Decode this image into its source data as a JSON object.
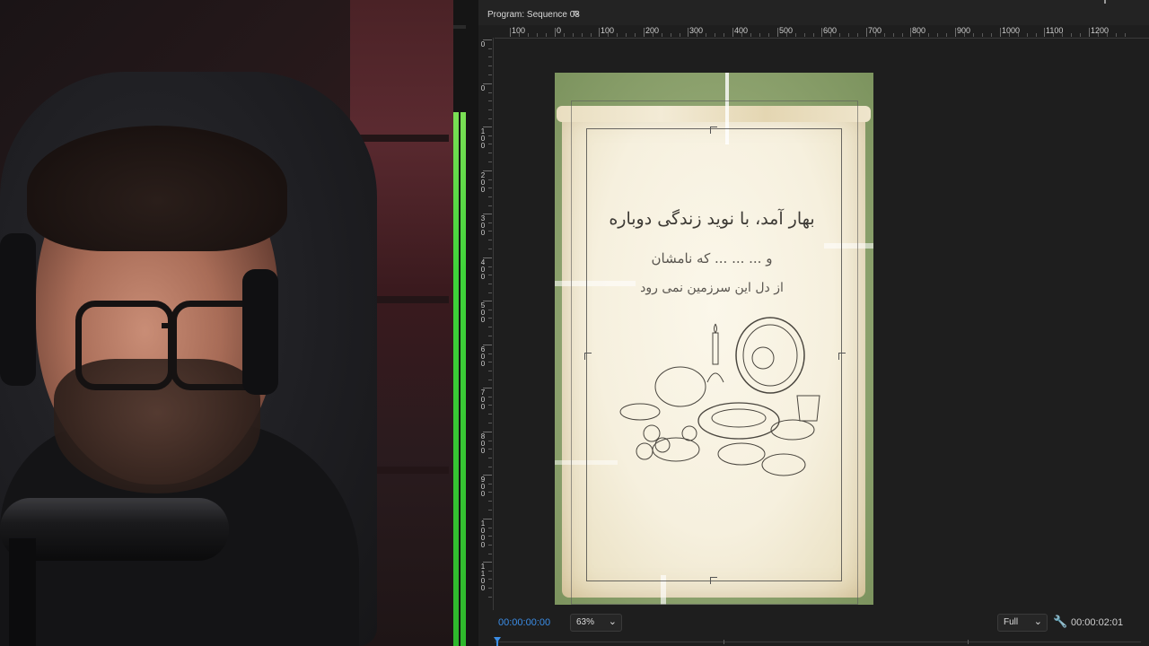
{
  "program": {
    "title": "Program: Sequence 03",
    "menu_icon": "hamburger-menu-icon",
    "timecode": "00:00:00:00",
    "zoom": "63%",
    "resolution": "Full",
    "duration": "00:00:02:01",
    "settings_icon": "wrench-icon",
    "dropdown_icon": "chevron-down-icon"
  },
  "ruler": {
    "h_labels": [
      "100",
      "0",
      "100",
      "200",
      "300",
      "400",
      "500",
      "600",
      "700",
      "800",
      "900",
      "1000",
      "1100",
      "1200"
    ],
    "v_labels": [
      "0",
      "0",
      "100",
      "200",
      "300",
      "400",
      "500",
      "600",
      "700",
      "800",
      "900",
      "1000",
      "1100"
    ]
  },
  "poem": {
    "line1": "بهار آمد، با نوید زندگی دوباره",
    "line2": "و ... ... ... که نامشان",
    "line3": "از دل این سرزمین نمی رود"
  },
  "colors": {
    "accent_blue": "#3b8de6",
    "meter_green": "#3fd43a",
    "panel_bg": "#1e1e1e",
    "background_green": "#8fa470",
    "paper": "#f6f0de"
  }
}
